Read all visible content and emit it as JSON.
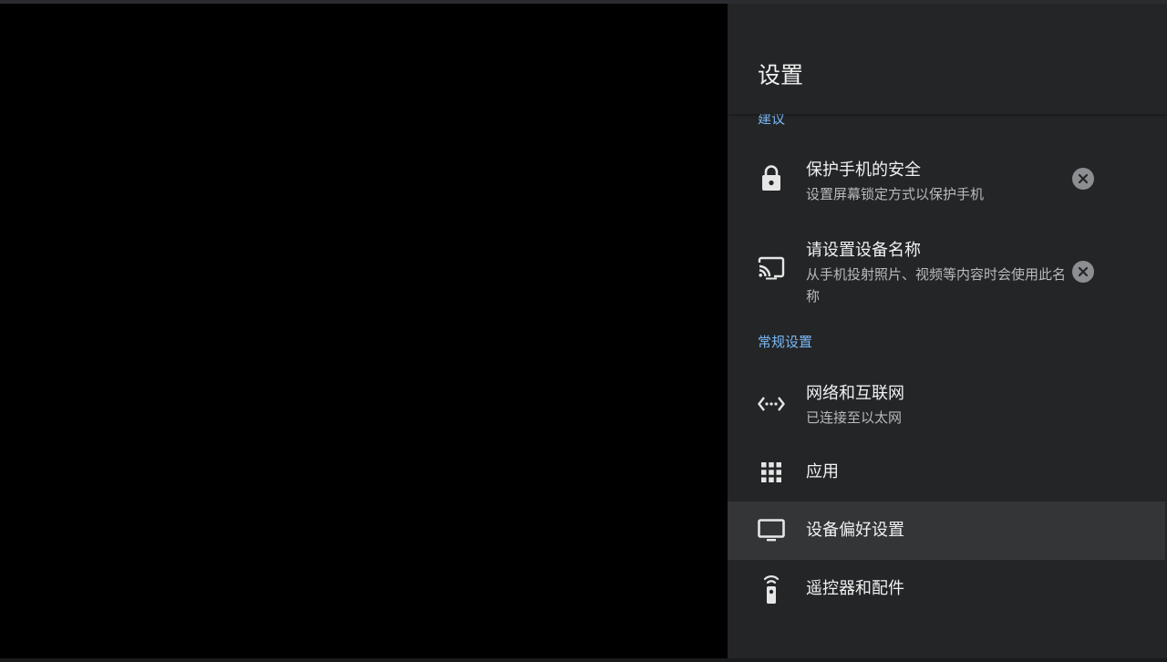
{
  "panel": {
    "title": "设置"
  },
  "suggestions": {
    "section_label": "建议",
    "items": [
      {
        "title": "保护手机的安全",
        "subtitle": "设置屏幕锁定方式以保护手机",
        "icon": "lock-icon"
      },
      {
        "title": "请设置设备名称",
        "subtitle": "从手机投射照片、视频等内容时会使用此名称",
        "icon": "cast-icon"
      }
    ]
  },
  "general": {
    "section_label": "常规设置",
    "items": [
      {
        "title": "网络和互联网",
        "subtitle": "已连接至以太网",
        "icon": "ethernet-icon"
      },
      {
        "title": "应用",
        "icon": "apps-grid-icon"
      },
      {
        "title": "设备偏好设置",
        "icon": "tv-icon",
        "focused": true
      },
      {
        "title": "遥控器和配件",
        "icon": "remote-icon"
      }
    ]
  },
  "colors": {
    "panel_background": "#232527",
    "focused_row": "#333537",
    "section_label": "#7ab8f5",
    "primary_text": "#f1f1f1",
    "secondary_text": "#b8babd",
    "dismiss_button": "#8c8e91"
  }
}
